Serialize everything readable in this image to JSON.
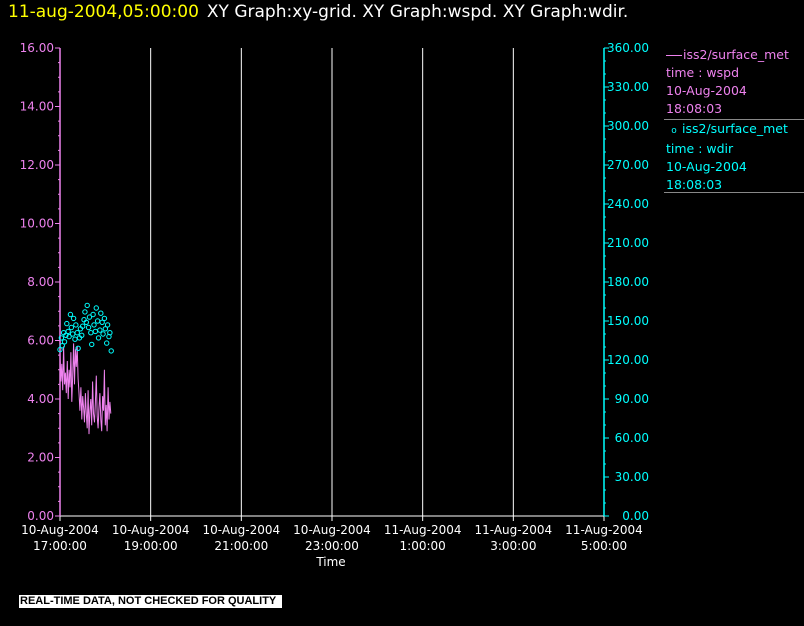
{
  "header": {
    "time": "11-aug-2004,05:00:00",
    "graphs": "XY Graph:xy-grid.  XY Graph:wspd.  XY Graph:wdir."
  },
  "legend": [
    {
      "symbol": "line",
      "name": "iss2/surface_met",
      "var": "time : wspd",
      "date": "10-Aug-2004",
      "time": "18:08:03",
      "color": "#ee82ee"
    },
    {
      "symbol": "circle",
      "name": "iss2/surface_met",
      "var": "time : wdir",
      "date": "10-Aug-2004",
      "time": "18:08:03",
      "color": "#00ffff"
    }
  ],
  "disclaimer": "REAL-TIME DATA, NOT CHECKED FOR QUALITY",
  "chart_data": {
    "type": "line",
    "title": "",
    "xlabel": "Time",
    "xlim": [
      17,
      29
    ],
    "x_ticks": [
      {
        "value": 17,
        "date": "10-Aug-2004",
        "time": "17:00:00"
      },
      {
        "value": 19,
        "date": "10-Aug-2004",
        "time": "19:00:00"
      },
      {
        "value": 21,
        "date": "10-Aug-2004",
        "time": "21:00:00"
      },
      {
        "value": 23,
        "date": "10-Aug-2004",
        "time": "23:00:00"
      },
      {
        "value": 25,
        "date": "11-Aug-2004",
        "time": "1:00:00"
      },
      {
        "value": 27,
        "date": "11-Aug-2004",
        "time": "3:00:00"
      },
      {
        "value": 29,
        "date": "11-Aug-2004",
        "time": "5:00:00"
      }
    ],
    "grid": "vertical",
    "y_left": {
      "ylim": [
        0,
        16
      ],
      "ticks": [
        "0.00",
        "2.00",
        "4.00",
        "6.00",
        "8.00",
        "10.00",
        "12.00",
        "14.00",
        "16.00"
      ],
      "color": "#ee82ee"
    },
    "y_right": {
      "ylim": [
        0,
        360
      ],
      "ticks": [
        "0.00",
        "30.00",
        "60.00",
        "90.00",
        "120.00",
        "150.00",
        "180.00",
        "210.00",
        "240.00",
        "270.00",
        "300.00",
        "330.00",
        "360.00"
      ],
      "color": "#00ffff"
    },
    "series": [
      {
        "name": "iss2/surface_met time : wspd",
        "axis": "left",
        "style": "line",
        "color": "#ee82ee",
        "x": [
          17.0,
          17.02,
          17.04,
          17.06,
          17.08,
          17.1,
          17.12,
          17.14,
          17.16,
          17.18,
          17.2,
          17.22,
          17.24,
          17.26,
          17.28,
          17.3,
          17.32,
          17.34,
          17.36,
          17.38,
          17.4,
          17.42,
          17.44,
          17.46,
          17.48,
          17.5,
          17.52,
          17.54,
          17.56,
          17.58,
          17.6,
          17.62,
          17.64,
          17.66,
          17.68,
          17.7,
          17.72,
          17.74,
          17.76,
          17.78,
          17.8,
          17.82,
          17.84,
          17.86,
          17.88,
          17.9,
          17.92,
          17.94,
          17.96,
          17.98,
          18.0,
          18.02,
          18.04,
          18.06,
          18.08,
          18.1,
          18.12
        ],
        "y": [
          5.5,
          4.6,
          5.2,
          4.3,
          5.8,
          4.5,
          4.9,
          4.2,
          5.3,
          4.0,
          5.0,
          4.4,
          5.6,
          3.9,
          4.8,
          5.9,
          4.5,
          5.7,
          5.1,
          5.8,
          4.7,
          4.2,
          3.6,
          4.4,
          3.3,
          4.1,
          3.7,
          3.2,
          4.2,
          3.5,
          3.0,
          4.3,
          2.8,
          3.6,
          4.0,
          3.1,
          4.6,
          3.5,
          3.2,
          3.9,
          4.8,
          3.4,
          3.0,
          3.7,
          4.2,
          3.3,
          2.9,
          4.1,
          3.6,
          5.0,
          3.1,
          3.8,
          2.9,
          4.4,
          3.3,
          3.9,
          3.5
        ]
      },
      {
        "name": "iss2/surface_met time : wdir",
        "axis": "right",
        "style": "circle",
        "color": "#00ffff",
        "x": [
          17.0,
          17.03,
          17.05,
          17.08,
          17.1,
          17.13,
          17.15,
          17.18,
          17.2,
          17.23,
          17.25,
          17.28,
          17.3,
          17.33,
          17.35,
          17.38,
          17.4,
          17.43,
          17.45,
          17.48,
          17.5,
          17.53,
          17.55,
          17.58,
          17.6,
          17.63,
          17.65,
          17.68,
          17.7,
          17.73,
          17.75,
          17.78,
          17.8,
          17.83,
          17.85,
          17.88,
          17.9,
          17.93,
          17.95,
          17.98,
          18.0,
          18.03,
          18.05,
          18.08,
          18.1,
          18.13
        ],
        "y": [
          128,
          137,
          131,
          141,
          134,
          139,
          148,
          142,
          138,
          155,
          145,
          140,
          152,
          136,
          147,
          141,
          129,
          137,
          144,
          139,
          146,
          151,
          157,
          149,
          162,
          145,
          153,
          141,
          132,
          155,
          147,
          142,
          160,
          150,
          137,
          143,
          156,
          149,
          140,
          152,
          144,
          133,
          147,
          138,
          141,
          127
        ]
      }
    ]
  }
}
